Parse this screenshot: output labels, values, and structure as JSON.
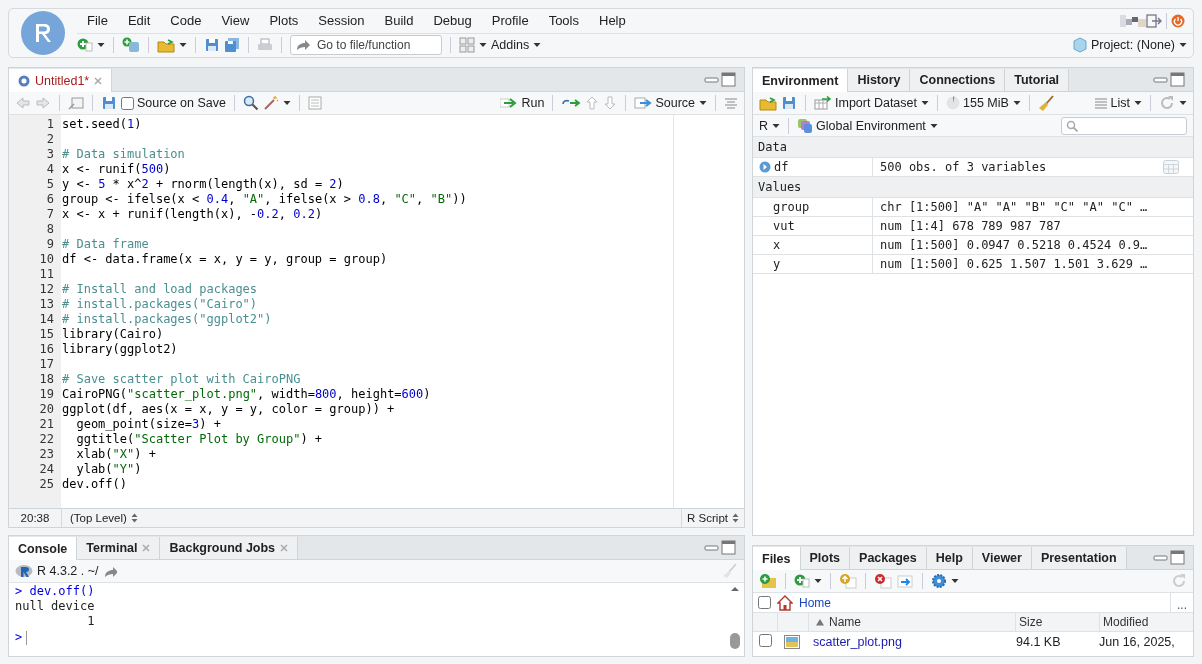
{
  "menu_bar": {
    "items": [
      "File",
      "Edit",
      "Code",
      "View",
      "Plots",
      "Session",
      "Build",
      "Debug",
      "Profile",
      "Tools",
      "Help"
    ]
  },
  "toolbar": {
    "goto_placeholder": "Go to file/function",
    "addins": "Addins",
    "project": "Project: (None)"
  },
  "editor": {
    "tabs": [
      {
        "label": "Untitled1*",
        "selected": true
      }
    ],
    "source_on_save": {
      "label": "Source on Save",
      "checked": false
    },
    "run": "Run",
    "source": "Source",
    "lines": [
      {
        "number": "1",
        "code": "set.seed(1)"
      },
      {
        "number": "2"
      },
      {
        "number": "3",
        "code": "# Data simulation"
      },
      {
        "number": "4",
        "code": "x <- runif(500)"
      },
      {
        "number": "5",
        "code": "y <- 5 * x^2 + rnorm(length(x), sd = 2)"
      },
      {
        "number": "6",
        "code": "group <- ifelse(x < 0.4, \"A\", ifelse(x > 0.8, \"C\", \"B\"))"
      },
      {
        "number": "7",
        "code": "x <- x + runif(length(x), -0.2, 0.2)"
      },
      {
        "number": "8"
      },
      {
        "number": "9",
        "code": "# Data frame"
      },
      {
        "number": "10",
        "code": "df <- data.frame(x = x, y = y, group = group)"
      },
      {
        "number": "11"
      },
      {
        "number": "12",
        "code": "# Install and load packages"
      },
      {
        "number": "13",
        "code": "# install.packages(\"Cairo\")"
      },
      {
        "number": "14",
        "code": "# install.packages(\"ggplot2\")"
      },
      {
        "number": "15",
        "code": "library(Cairo)"
      },
      {
        "number": "16",
        "code": "library(ggplot2)"
      },
      {
        "number": "17"
      },
      {
        "number": "18",
        "code": "# Save scatter plot with CairoPNG"
      },
      {
        "number": "19",
        "code": "CairoPNG(\"scatter_plot.png\", width=800, height=600)"
      },
      {
        "number": "20",
        "code": "ggplot(df, aes(x = x, y = y, color = group)) +"
      },
      {
        "number": "21",
        "code": "  geom_point(size=3) +"
      },
      {
        "number": "22",
        "code": "  ggtitle(\"Scatter Plot by Group\") +"
      },
      {
        "number": "23",
        "code": "  xlab(\"X\") +"
      },
      {
        "number": "24",
        "code": "  ylab(\"Y\")"
      },
      {
        "number": "25",
        "code": "dev.off()"
      }
    ],
    "status": {
      "position": "20:38",
      "scope": "(Top Level)",
      "file_type": "R Script"
    }
  },
  "console": {
    "tabs": [
      {
        "label": "Console",
        "selected": true,
        "closable": false
      },
      {
        "label": "Terminal",
        "selected": false,
        "closable": true
      },
      {
        "label": "Background Jobs",
        "selected": false,
        "closable": true
      }
    ],
    "version": "R 4.3.2 . ~/",
    "lines": [
      {
        "kind": "input",
        "text": "> dev.off()"
      },
      {
        "kind": "output",
        "text": "null device"
      },
      {
        "kind": "output",
        "text": "          1"
      }
    ],
    "prompt": ">"
  },
  "environment": {
    "tabs": [
      {
        "label": "Environment",
        "selected": true
      },
      {
        "label": "History",
        "selected": false
      },
      {
        "label": "Connections",
        "selected": false
      },
      {
        "label": "Tutorial",
        "selected": false
      }
    ],
    "import_dataset": "Import Dataset",
    "memory": "155 MiB",
    "view": "List",
    "language": "R",
    "scope": "Global Environment",
    "sections": [
      {
        "title": "Data",
        "rows": [
          {
            "kind": "data",
            "name": "df",
            "value": "500 obs. of 3 variables"
          }
        ]
      },
      {
        "title": "Values",
        "rows": [
          {
            "kind": "value",
            "name": "group",
            "value": "chr [1:500] \"A\" \"A\" \"B\" \"C\" \"A\" \"C\" …"
          },
          {
            "kind": "value",
            "name": "vut",
            "value": "num [1:4] 678 789 987 787"
          },
          {
            "kind": "value",
            "name": "x",
            "value": "num [1:500] 0.0947 0.5218 0.4524 0.9…"
          },
          {
            "kind": "value",
            "name": "y",
            "value": "num [1:500] 0.625 1.507 1.501 3.629 …"
          }
        ]
      }
    ]
  },
  "files": {
    "tabs": [
      {
        "label": "Files",
        "selected": true
      },
      {
        "label": "Plots",
        "selected": false
      },
      {
        "label": "Packages",
        "selected": false
      },
      {
        "label": "Help",
        "selected": false
      },
      {
        "label": "Viewer",
        "selected": false
      },
      {
        "label": "Presentation",
        "selected": false
      }
    ],
    "select_all_checked": false,
    "breadcrumb": "Home",
    "more": "...",
    "columns": [
      "Name",
      "Size",
      "Modified"
    ],
    "rows": [
      {
        "name": "scatter_plot.png",
        "size": "94.1 KB",
        "modified": "Jun 16, 2025,",
        "checked": false
      }
    ]
  }
}
